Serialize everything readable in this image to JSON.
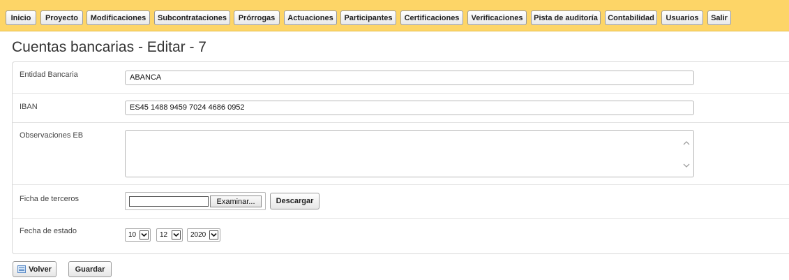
{
  "menu": {
    "items": [
      {
        "label": "Inicio"
      },
      {
        "label": "Proyecto"
      },
      {
        "label": "Modificaciones"
      },
      {
        "label": "Subcontrataciones"
      },
      {
        "label": "Prórrogas"
      },
      {
        "label": "Actuaciones"
      },
      {
        "label": "Participantes"
      },
      {
        "label": "Certificaciones"
      },
      {
        "label": "Verificaciones"
      },
      {
        "label": "Pista de auditoría"
      },
      {
        "label": "Contabilidad"
      },
      {
        "label": "Usuarios"
      },
      {
        "label": "Salir"
      }
    ]
  },
  "page": {
    "title": "Cuentas bancarias - Editar - 7"
  },
  "form": {
    "entidad": {
      "label": "Entidad Bancaria",
      "value": "ABANCA"
    },
    "iban": {
      "label": "IBAN",
      "value": "ES45 1488 9459 7024 4686 0952"
    },
    "observaciones": {
      "label": "Observaciones EB",
      "value": ""
    },
    "ficha": {
      "label": "Ficha de terceros",
      "browse_label": "Examinar...",
      "download_label": "Descargar"
    },
    "fecha": {
      "label": "Fecha de estado",
      "day": "10",
      "month": "12",
      "year": "2020"
    }
  },
  "footer": {
    "back_label": "Volver",
    "save_label": "Guardar"
  },
  "colors": {
    "menubar": "#fdd567"
  },
  "icons": {
    "back": "list-icon",
    "dropdown": "chevron-down-icon",
    "scroll_up": "chevron-up-icon",
    "scroll_down": "chevron-down-icon"
  }
}
